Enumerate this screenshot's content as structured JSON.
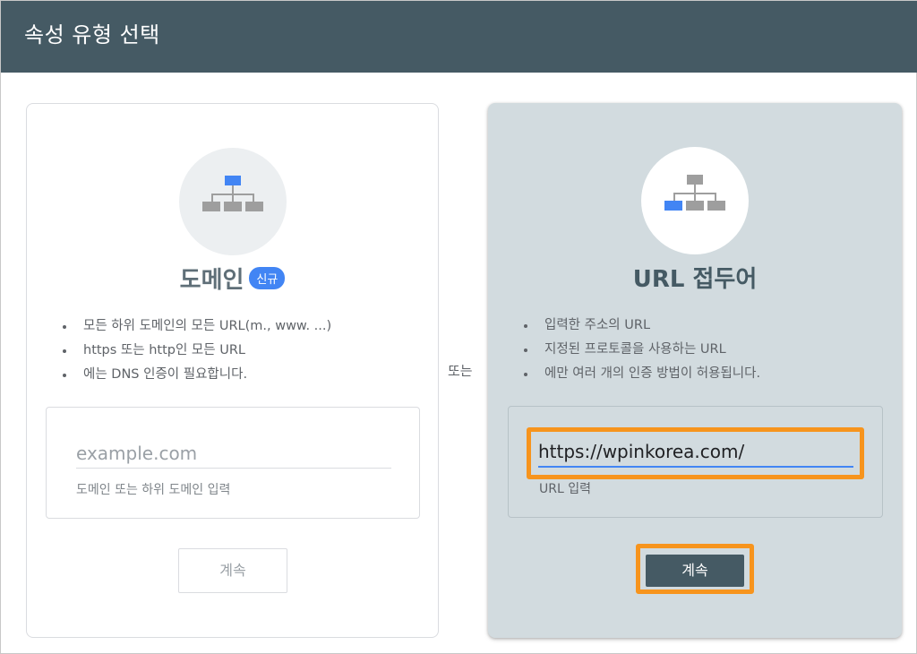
{
  "header": {
    "title": "속성 유형 선택"
  },
  "separator": "또는",
  "domain_card": {
    "title": "도메인",
    "badge": "신규",
    "bullets": [
      "모든 하위 도메인의 모든 URL(m., www. ...)",
      "https 또는 http인 모든 URL",
      "에는 DNS 인증이 필요합니다."
    ],
    "input": {
      "placeholder": "example.com",
      "value": "",
      "help": "도메인 또는 하위 도메인 입력"
    },
    "button": "계속",
    "icon": "sitemap-icon"
  },
  "url_prefix_card": {
    "title": "URL 접두어",
    "bullets": [
      "입력한 주소의 URL",
      "지정된 프로토콜을 사용하는 URL",
      "에만 여러 개의 인증 방법이 허용됩니다."
    ],
    "input": {
      "placeholder": "",
      "value": "https://wpinkorea.com/",
      "help": "URL 입력"
    },
    "button": "계속",
    "icon": "sitemap-icon"
  },
  "colors": {
    "header_bg": "#455a64",
    "accent_blue": "#4285f4",
    "highlight_orange": "#f7941d",
    "selected_card_bg": "#d2dbdf"
  }
}
